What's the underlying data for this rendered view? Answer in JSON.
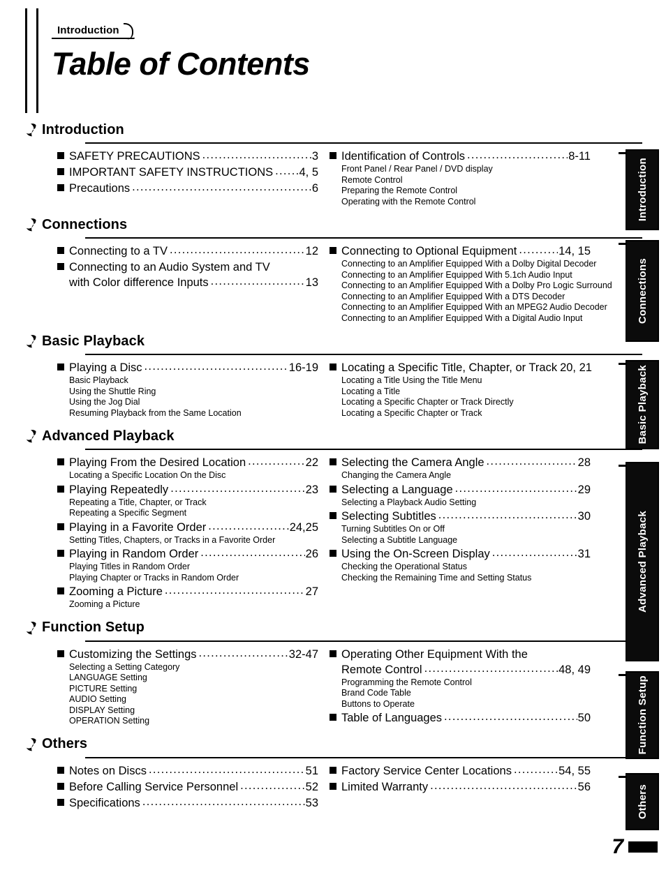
{
  "header": {
    "chapter_tag": "Introduction",
    "title": "Table of Contents"
  },
  "folio": {
    "page_number": "7"
  },
  "side_tabs": [
    {
      "label": "Introduction"
    },
    {
      "label": "Connections"
    },
    {
      "label": "Basic Playback"
    },
    {
      "label": "Advanced Playback"
    },
    {
      "label": "Function Setup"
    },
    {
      "label": "Others"
    }
  ],
  "sections": [
    {
      "title": "Introduction",
      "left": [
        {
          "label": "SAFETY PRECAUTIONS",
          "pages": "3",
          "subs": []
        },
        {
          "label": "IMPORTANT SAFETY INSTRUCTIONS",
          "pages": "4, 5",
          "subs": []
        },
        {
          "label": "Precautions",
          "pages": "6",
          "subs": []
        }
      ],
      "right": [
        {
          "label": "Identification of Controls",
          "pages": "8-11",
          "subs": [
            "Front Panel / Rear Panel / DVD display",
            "Remote Control",
            "Preparing the Remote Control",
            "Operating with the Remote Control"
          ]
        }
      ]
    },
    {
      "title": "Connections",
      "left": [
        {
          "label": "Connecting to a TV",
          "pages": "12",
          "subs": []
        },
        {
          "label": "Connecting to an Audio System and TV",
          "label2": "with Color difference Inputs",
          "pages": "13",
          "subs": []
        }
      ],
      "right": [
        {
          "label": "Connecting to Optional Equipment",
          "pages": "14, 15",
          "subs": [
            "Connecting to an Amplifier Equipped With a Dolby Digital Decoder",
            "Connecting to an Amplifier Equipped With 5.1ch Audio Input",
            "Connecting to an Amplifier Equipped With a Dolby Pro Logic Surround",
            "Connecting to an Amplifier Equipped With a DTS Decoder",
            "Connecting to an Amplifier Equipped With an MPEG2 Audio Decoder",
            "Connecting to an Amplifier Equipped With a Digital Audio Input"
          ]
        }
      ]
    },
    {
      "title": "Basic Playback",
      "left": [
        {
          "label": "Playing a Disc",
          "pages": "16-19",
          "subs": [
            "Basic Playback",
            "Using the Shuttle Ring",
            "Using the Jog Dial",
            "Resuming Playback from the Same Location"
          ]
        }
      ],
      "right": [
        {
          "label": "Locating a Specific Title, Chapter, or Track",
          "pages": "20, 21",
          "subs": [
            "Locating a Title Using the Title Menu",
            "Locating a Title",
            "Locating a Specific Chapter or Track Directly",
            "Locating a Specific Chapter or Track"
          ]
        }
      ]
    },
    {
      "title": "Advanced Playback",
      "left": [
        {
          "label": "Playing From the Desired Location",
          "pages": "22",
          "subs": [
            "Locating a Specific Location On the Disc"
          ]
        },
        {
          "label": "Playing Repeatedly",
          "pages": "23",
          "subs": [
            "Repeating a Title, Chapter, or Track",
            "Repeating a Specific Segment"
          ]
        },
        {
          "label": "Playing in a Favorite Order",
          "pages": "24,25",
          "subs": [
            "Setting Titles, Chapters, or Tracks in a Favorite Order"
          ]
        },
        {
          "label": "Playing in Random Order",
          "pages": "26",
          "subs": [
            "Playing Titles in Random Order",
            "Playing Chapter or Tracks in Random Order"
          ]
        },
        {
          "label": "Zooming a Picture",
          "pages": "27",
          "subs": [
            "Zooming a Picture"
          ]
        }
      ],
      "right": [
        {
          "label": "Selecting the Camera Angle",
          "pages": "28",
          "subs": [
            "Changing the Camera Angle"
          ]
        },
        {
          "label": "Selecting a Language",
          "pages": "29",
          "subs": [
            "Selecting a Playback Audio Setting"
          ]
        },
        {
          "label": "Selecting Subtitles",
          "pages": "30",
          "subs": [
            "Turning Subtitles On or Off",
            "Selecting a Subtitle Language"
          ]
        },
        {
          "label": "Using the On-Screen Display",
          "pages": "31",
          "subs": [
            "Checking the Operational Status",
            "Checking the Remaining Time and Setting Status"
          ]
        }
      ]
    },
    {
      "title": "Function Setup",
      "left": [
        {
          "label": "Customizing the Settings",
          "pages": "32-47",
          "subs": [
            "Selecting a Setting Category",
            "LANGUAGE Setting",
            "PICTURE Setting",
            "AUDIO Setting",
            "DISPLAY Setting",
            "OPERATION Setting"
          ]
        }
      ],
      "right": [
        {
          "label": "Operating Other Equipment With the",
          "label2": "Remote Control",
          "pages": "48, 49",
          "subs": [
            "Programming the Remote Control",
            "Brand Code Table",
            "Buttons to Operate"
          ]
        },
        {
          "label": "Table of Languages",
          "pages": "50",
          "subs": []
        }
      ]
    },
    {
      "title": "Others",
      "left": [
        {
          "label": "Notes on Discs",
          "pages": "51",
          "subs": []
        },
        {
          "label": "Before Calling Service Personnel",
          "pages": "52",
          "subs": []
        },
        {
          "label": "Specifications",
          "pages": "53",
          "subs": []
        }
      ],
      "right": [
        {
          "label": "Factory Service Center Locations",
          "pages": "54, 55",
          "subs": []
        },
        {
          "label": "Limited Warranty",
          "pages": "56",
          "subs": []
        }
      ]
    }
  ]
}
